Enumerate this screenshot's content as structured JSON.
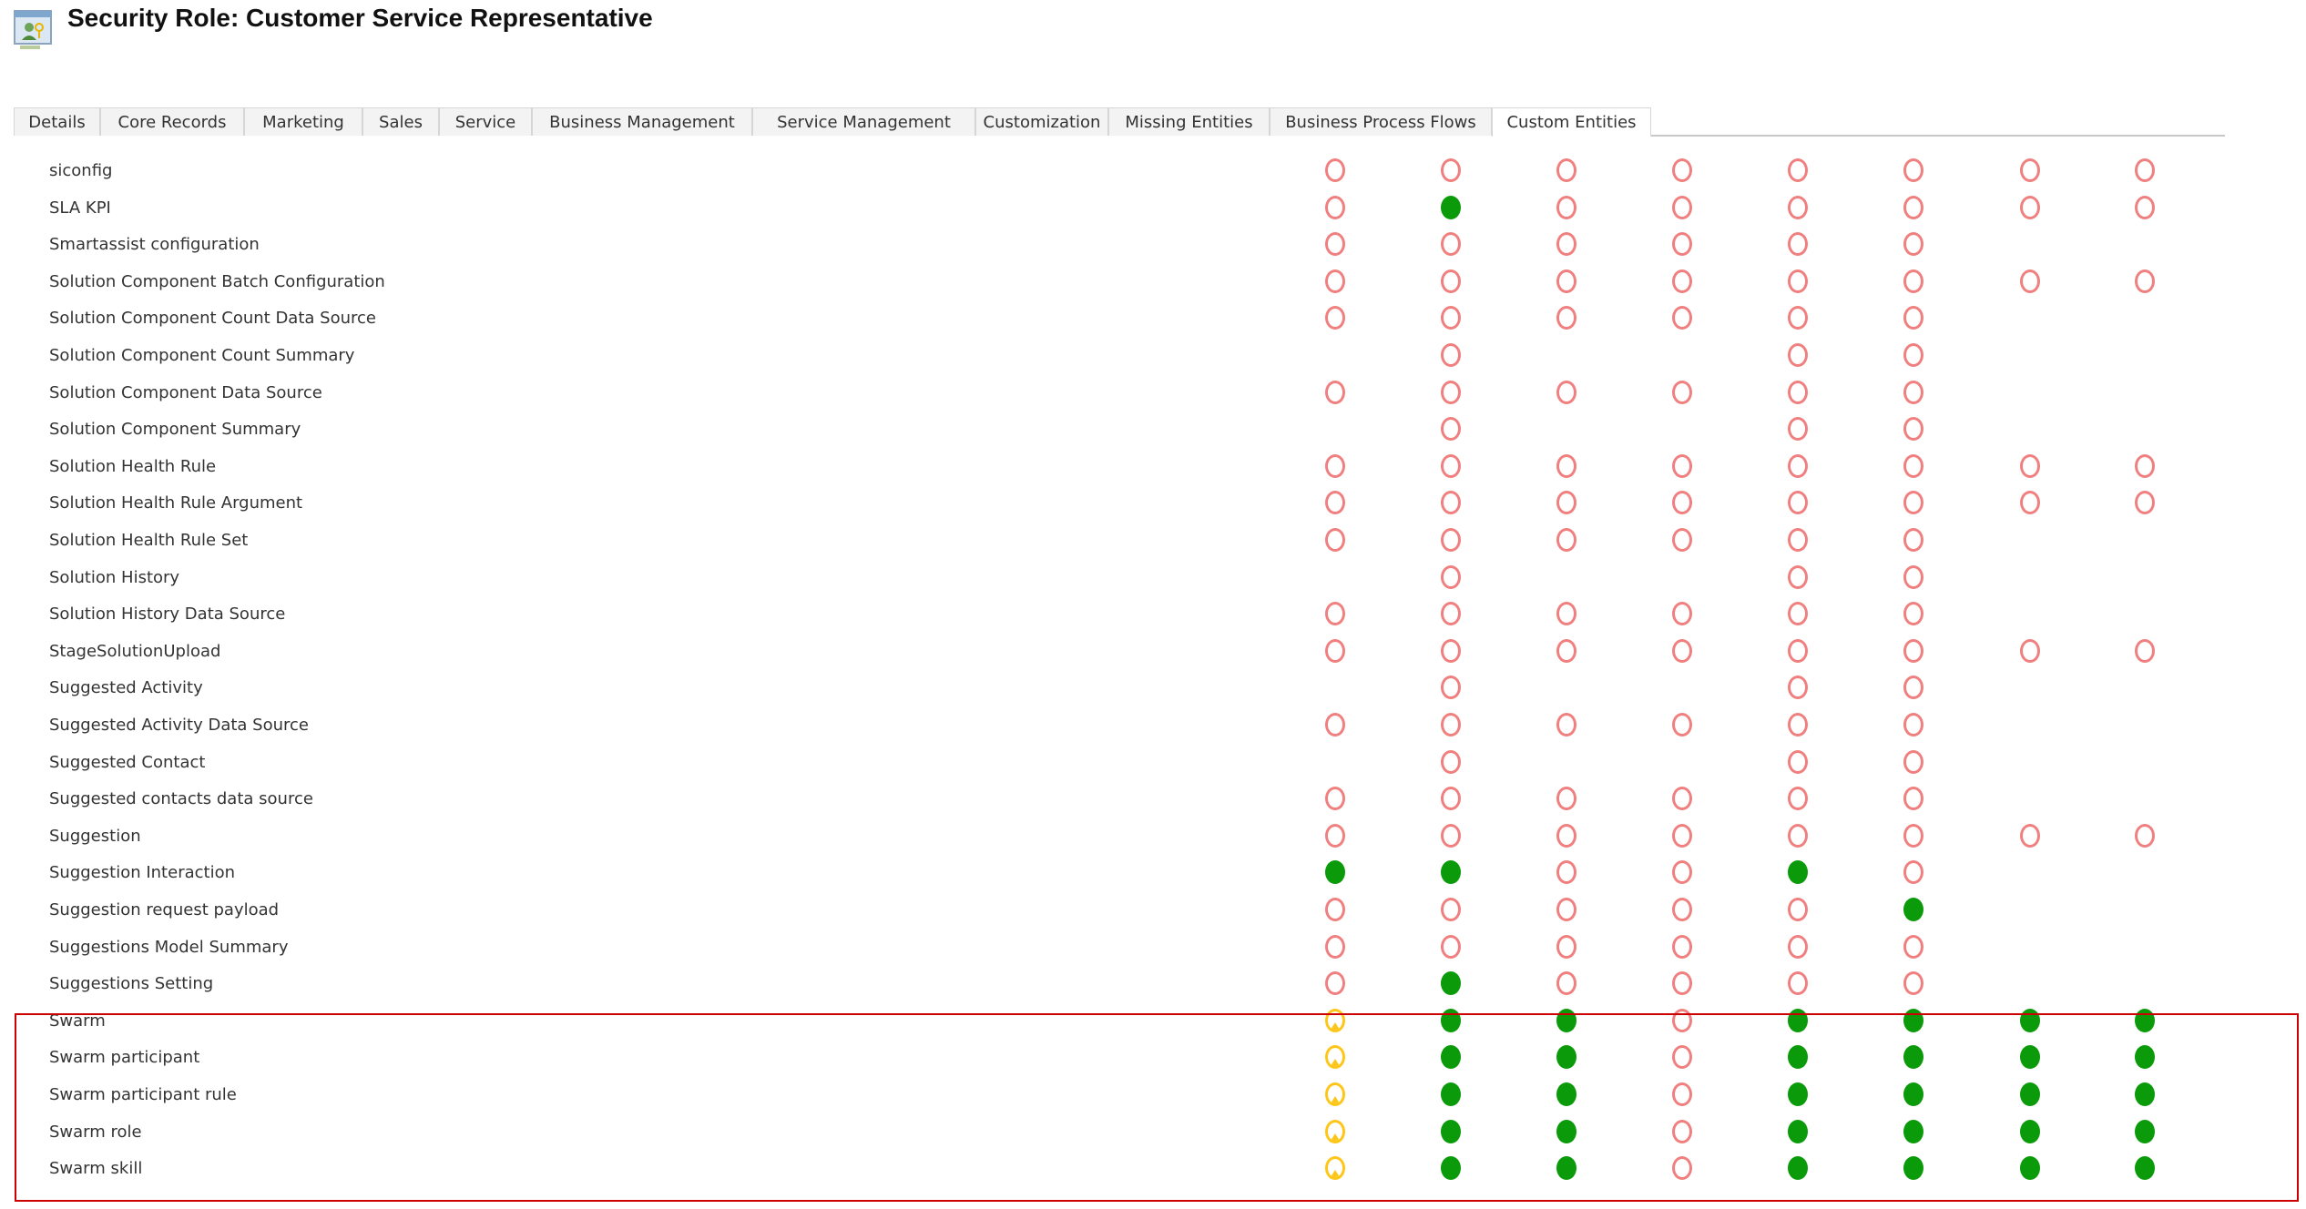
{
  "header": {
    "title": "Security Role: Customer Service Representative",
    "icon": "security-role-icon"
  },
  "tabs": [
    {
      "label": "Details",
      "w": 95
    },
    {
      "label": "Core Records",
      "w": 158
    },
    {
      "label": "Marketing",
      "w": 130
    },
    {
      "label": "Sales",
      "w": 84
    },
    {
      "label": "Service",
      "w": 102
    },
    {
      "label": "Business Management",
      "w": 242
    },
    {
      "label": "Service Management",
      "w": 245
    },
    {
      "label": "Customization",
      "w": 146
    },
    {
      "label": "Missing Entities",
      "w": 177
    },
    {
      "label": "Business Process Flows",
      "w": 244
    },
    {
      "label": "Custom Entities",
      "w": 175
    }
  ],
  "active_tab": "Custom Entities",
  "legend_levels": {
    "empty": "none",
    "full": "organization",
    "user": "user"
  },
  "colors": {
    "empty": "#f08080",
    "full": "#0a9a0a",
    "user": "#ffc61a",
    "highlight": "#cc0000"
  },
  "rows": [
    {
      "name": "siconfig",
      "levels": [
        "empty",
        "empty",
        "empty",
        "empty",
        "empty",
        "empty",
        "empty",
        "empty"
      ]
    },
    {
      "name": "SLA KPI",
      "levels": [
        "empty",
        "full",
        "empty",
        "empty",
        "empty",
        "empty",
        "empty",
        "empty"
      ]
    },
    {
      "name": "Smartassist configuration",
      "levels": [
        "empty",
        "empty",
        "empty",
        "empty",
        "empty",
        "empty",
        "",
        ""
      ]
    },
    {
      "name": "Solution Component Batch Configuration",
      "levels": [
        "empty",
        "empty",
        "empty",
        "empty",
        "empty",
        "empty",
        "empty",
        "empty"
      ]
    },
    {
      "name": "Solution Component Count Data Source",
      "levels": [
        "empty",
        "empty",
        "empty",
        "empty",
        "empty",
        "empty",
        "",
        ""
      ]
    },
    {
      "name": "Solution Component Count Summary",
      "levels": [
        "",
        "empty",
        "",
        "",
        "empty",
        "empty",
        "",
        ""
      ]
    },
    {
      "name": "Solution Component Data Source",
      "levels": [
        "empty",
        "empty",
        "empty",
        "empty",
        "empty",
        "empty",
        "",
        ""
      ]
    },
    {
      "name": "Solution Component Summary",
      "levels": [
        "",
        "empty",
        "",
        "",
        "empty",
        "empty",
        "",
        ""
      ]
    },
    {
      "name": "Solution Health Rule",
      "levels": [
        "empty",
        "empty",
        "empty",
        "empty",
        "empty",
        "empty",
        "empty",
        "empty"
      ]
    },
    {
      "name": "Solution Health Rule Argument",
      "levels": [
        "empty",
        "empty",
        "empty",
        "empty",
        "empty",
        "empty",
        "empty",
        "empty"
      ]
    },
    {
      "name": "Solution Health Rule Set",
      "levels": [
        "empty",
        "empty",
        "empty",
        "empty",
        "empty",
        "empty",
        "",
        ""
      ]
    },
    {
      "name": "Solution History",
      "levels": [
        "",
        "empty",
        "",
        "",
        "empty",
        "empty",
        "",
        ""
      ]
    },
    {
      "name": "Solution History Data Source",
      "levels": [
        "empty",
        "empty",
        "empty",
        "empty",
        "empty",
        "empty",
        "",
        ""
      ]
    },
    {
      "name": "StageSolutionUpload",
      "levels": [
        "empty",
        "empty",
        "empty",
        "empty",
        "empty",
        "empty",
        "empty",
        "empty"
      ]
    },
    {
      "name": "Suggested Activity",
      "levels": [
        "",
        "empty",
        "",
        "",
        "empty",
        "empty",
        "",
        ""
      ]
    },
    {
      "name": "Suggested Activity Data Source",
      "levels": [
        "empty",
        "empty",
        "empty",
        "empty",
        "empty",
        "empty",
        "",
        ""
      ]
    },
    {
      "name": "Suggested Contact",
      "levels": [
        "",
        "empty",
        "",
        "",
        "empty",
        "empty",
        "",
        ""
      ]
    },
    {
      "name": "Suggested contacts data source",
      "levels": [
        "empty",
        "empty",
        "empty",
        "empty",
        "empty",
        "empty",
        "",
        ""
      ]
    },
    {
      "name": "Suggestion",
      "levels": [
        "empty",
        "empty",
        "empty",
        "empty",
        "empty",
        "empty",
        "empty",
        "empty"
      ]
    },
    {
      "name": "Suggestion Interaction",
      "levels": [
        "full",
        "full",
        "empty",
        "empty",
        "full",
        "empty",
        "",
        ""
      ]
    },
    {
      "name": "Suggestion request payload",
      "levels": [
        "empty",
        "empty",
        "empty",
        "empty",
        "empty",
        "full",
        "",
        ""
      ]
    },
    {
      "name": "Suggestions Model Summary",
      "levels": [
        "empty",
        "empty",
        "empty",
        "empty",
        "empty",
        "empty",
        "",
        ""
      ]
    },
    {
      "name": "Suggestions Setting",
      "levels": [
        "empty",
        "full",
        "empty",
        "empty",
        "empty",
        "empty",
        "",
        ""
      ]
    },
    {
      "name": "Swarm",
      "levels": [
        "user",
        "full",
        "full",
        "empty",
        "full",
        "full",
        "full",
        "full"
      ]
    },
    {
      "name": "Swarm participant",
      "levels": [
        "user",
        "full",
        "full",
        "empty",
        "full",
        "full",
        "full",
        "full"
      ]
    },
    {
      "name": "Swarm participant rule",
      "levels": [
        "user",
        "full",
        "full",
        "empty",
        "full",
        "full",
        "full",
        "full"
      ]
    },
    {
      "name": "Swarm role",
      "levels": [
        "user",
        "full",
        "full",
        "empty",
        "full",
        "full",
        "full",
        "full"
      ]
    },
    {
      "name": "Swarm skill",
      "levels": [
        "user",
        "full",
        "full",
        "empty",
        "full",
        "full",
        "full",
        "full"
      ]
    }
  ]
}
